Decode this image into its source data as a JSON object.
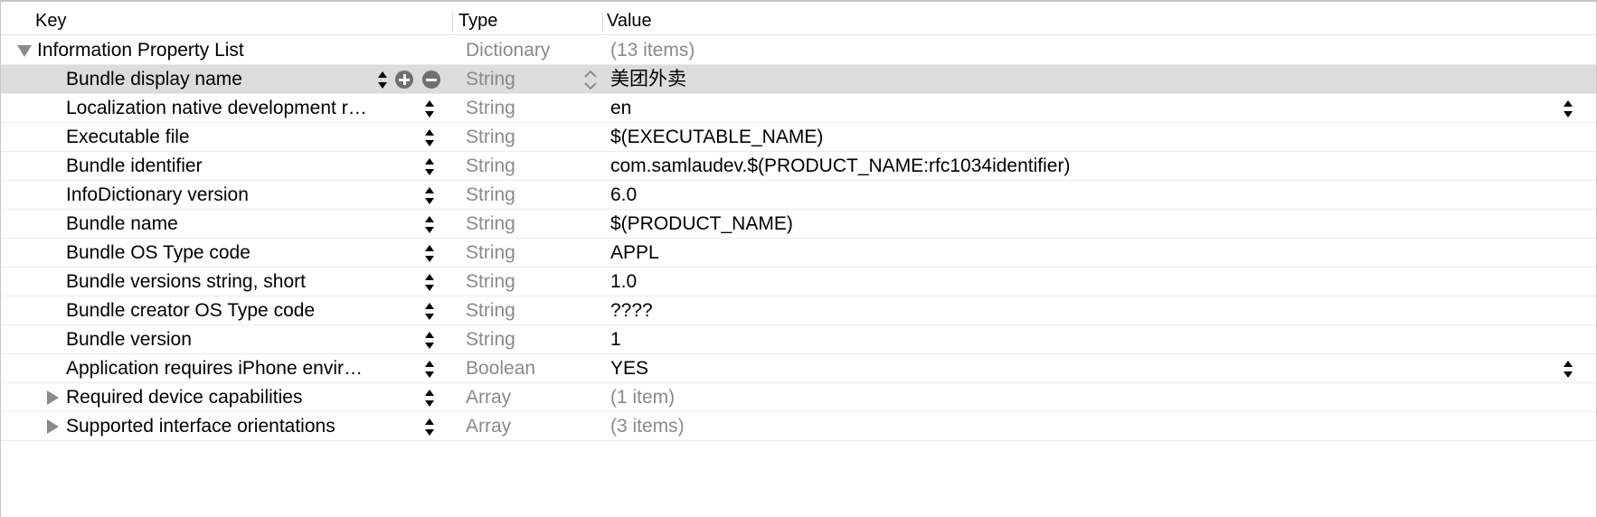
{
  "header": {
    "key_label": "Key",
    "type_label": "Type",
    "value_label": "Value"
  },
  "colors": {
    "selected_row": "#dcdcdc",
    "secondary_text": "#8a8a8a",
    "grid_line": "#ebebeb"
  },
  "rows": [
    {
      "key": "Information Property List",
      "type": "Dictionary",
      "value": "(13 items)",
      "disclosure": "open"
    },
    {
      "key": "Bundle display name",
      "type": "String",
      "value": "美团外卖",
      "selected": true
    },
    {
      "key": "Localization native development r…",
      "type": "String",
      "value": "en",
      "value_popup": true
    },
    {
      "key": "Executable file",
      "type": "String",
      "value": "$(EXECUTABLE_NAME)"
    },
    {
      "key": "Bundle identifier",
      "type": "String",
      "value": "com.samlaudev.$(PRODUCT_NAME:rfc1034identifier)"
    },
    {
      "key": "InfoDictionary version",
      "type": "String",
      "value": "6.0"
    },
    {
      "key": "Bundle name",
      "type": "String",
      "value": "$(PRODUCT_NAME)"
    },
    {
      "key": "Bundle OS Type code",
      "type": "String",
      "value": "APPL"
    },
    {
      "key": "Bundle versions string, short",
      "type": "String",
      "value": "1.0"
    },
    {
      "key": "Bundle creator OS Type code",
      "type": "String",
      "value": "????"
    },
    {
      "key": "Bundle version",
      "type": "String",
      "value": "1"
    },
    {
      "key": "Application requires iPhone envir…",
      "type": "Boolean",
      "value": "YES",
      "value_popup": true
    },
    {
      "key": "Required device capabilities",
      "type": "Array",
      "value": "(1 item)",
      "disclosure": "closed"
    },
    {
      "key": "Supported interface orientations",
      "type": "Array",
      "value": "(3 items)",
      "disclosure": "closed"
    }
  ]
}
